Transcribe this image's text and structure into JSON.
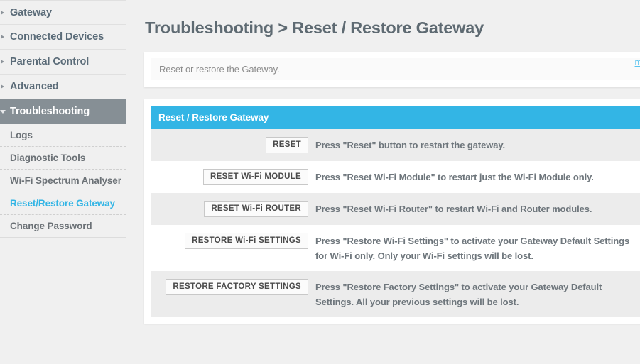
{
  "sidebar": {
    "top_items": [
      {
        "label": "Gateway",
        "active": false
      },
      {
        "label": "Connected Devices",
        "active": false
      },
      {
        "label": "Parental Control",
        "active": false
      },
      {
        "label": "Advanced",
        "active": false
      },
      {
        "label": "Troubleshooting",
        "active": true
      }
    ],
    "sub_items": [
      {
        "label": "Logs",
        "current": false
      },
      {
        "label": "Diagnostic Tools",
        "current": false
      },
      {
        "label": "Wi-Fi Spectrum Analyser",
        "current": false
      },
      {
        "label": "Reset/Restore Gateway",
        "current": true
      },
      {
        "label": "Change Password",
        "current": false
      }
    ]
  },
  "main": {
    "page_title": "Troubleshooting > Reset / Restore Gateway",
    "description": "Reset or restore the Gateway.",
    "more_label": "more",
    "card_title": "Reset / Restore Gateway",
    "rows": [
      {
        "button": "RESET",
        "description": "Press \"Reset\" button to restart the gateway."
      },
      {
        "button": "RESET Wi-Fi MODULE",
        "description": "Press \"Reset Wi-Fi Module\" to restart just the Wi-Fi Module only."
      },
      {
        "button": "RESET Wi-Fi ROUTER",
        "description": "Press \"Reset Wi-Fi Router\" to restart Wi-Fi and Router modules."
      },
      {
        "button": "RESTORE Wi-Fi SETTINGS",
        "description": "Press \"Restore Wi-Fi Settings\" to activate your Gateway Default Settings for Wi-Fi only. Only your Wi-Fi settings will be lost."
      },
      {
        "button": "RESTORE FACTORY SETTINGS",
        "description": "Press \"Restore Factory Settings\" to activate your Gateway Default Settings. All your previous settings will be lost."
      }
    ]
  },
  "colors": {
    "accent_blue": "#33b5e5",
    "active_nav_gray": "#868f95",
    "page_background": "#f0f0f0",
    "row_shaded": "#ececec",
    "text_gray": "#6e767c"
  }
}
